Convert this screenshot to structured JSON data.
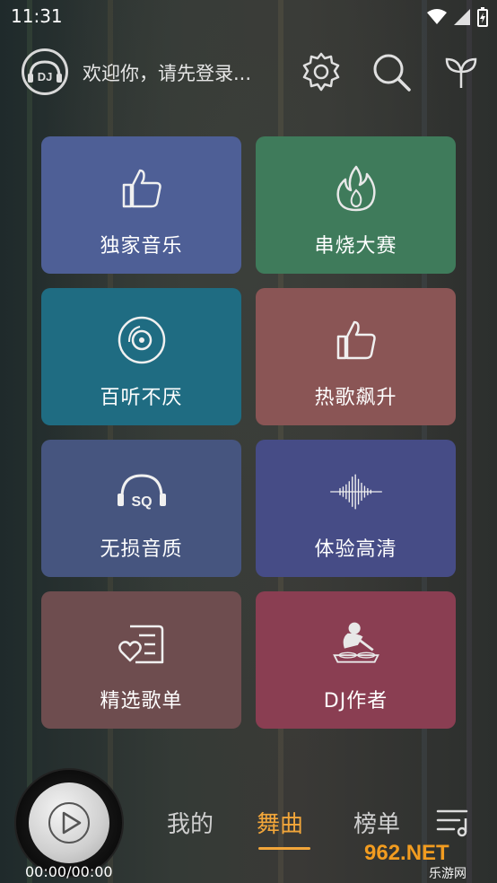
{
  "status": {
    "time": "11:31"
  },
  "header": {
    "logo_text": "DJ",
    "welcome": "欢迎你，请先登录...",
    "icons": [
      "gear-icon",
      "search-icon",
      "sprout-icon"
    ]
  },
  "tiles": [
    {
      "label": "独家音乐",
      "icon": "thumbs-up-icon",
      "color": "#4e5f96"
    },
    {
      "label": "串烧大赛",
      "icon": "flame-icon",
      "color": "#3f7b5b"
    },
    {
      "label": "百听不厌",
      "icon": "disc-icon",
      "color": "#1f6c82"
    },
    {
      "label": "热歌飙升",
      "icon": "thumbs-up-icon",
      "color": "#8a5555"
    },
    {
      "label": "无损音质",
      "icon": "sq-headphones-icon",
      "color": "#46557f"
    },
    {
      "label": "体验高清",
      "icon": "waveform-icon",
      "color": "#464c86"
    },
    {
      "label": "精选歌单",
      "icon": "heart-list-icon",
      "color": "#6e4d4f"
    },
    {
      "label": "DJ作者",
      "icon": "dj-person-icon",
      "color": "#8a3e52"
    }
  ],
  "player": {
    "time": "00:00/00:00"
  },
  "tabs": [
    {
      "label": "我的",
      "active": false
    },
    {
      "label": "舞曲",
      "active": true
    },
    {
      "label": "榜单",
      "active": false
    }
  ],
  "watermark": {
    "text": "962.NET",
    "subtext": "乐游网"
  }
}
